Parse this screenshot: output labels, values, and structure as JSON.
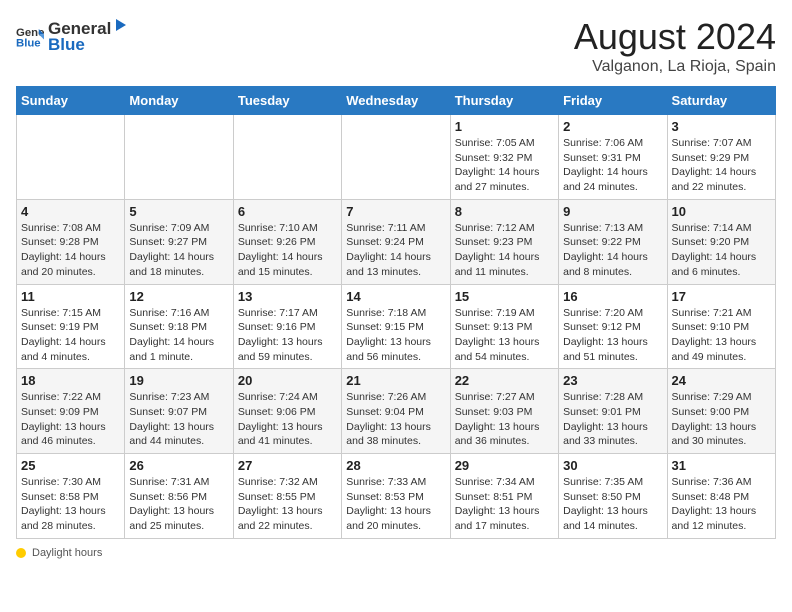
{
  "header": {
    "logo_general": "General",
    "logo_blue": "Blue",
    "month_year": "August 2024",
    "location": "Valganon, La Rioja, Spain"
  },
  "days_of_week": [
    "Sunday",
    "Monday",
    "Tuesday",
    "Wednesday",
    "Thursday",
    "Friday",
    "Saturday"
  ],
  "weeks": [
    [
      {
        "day": "",
        "info": ""
      },
      {
        "day": "",
        "info": ""
      },
      {
        "day": "",
        "info": ""
      },
      {
        "day": "",
        "info": ""
      },
      {
        "day": "1",
        "info": "Sunrise: 7:05 AM\nSunset: 9:32 PM\nDaylight: 14 hours and 27 minutes."
      },
      {
        "day": "2",
        "info": "Sunrise: 7:06 AM\nSunset: 9:31 PM\nDaylight: 14 hours and 24 minutes."
      },
      {
        "day": "3",
        "info": "Sunrise: 7:07 AM\nSunset: 9:29 PM\nDaylight: 14 hours and 22 minutes."
      }
    ],
    [
      {
        "day": "4",
        "info": "Sunrise: 7:08 AM\nSunset: 9:28 PM\nDaylight: 14 hours and 20 minutes."
      },
      {
        "day": "5",
        "info": "Sunrise: 7:09 AM\nSunset: 9:27 PM\nDaylight: 14 hours and 18 minutes."
      },
      {
        "day": "6",
        "info": "Sunrise: 7:10 AM\nSunset: 9:26 PM\nDaylight: 14 hours and 15 minutes."
      },
      {
        "day": "7",
        "info": "Sunrise: 7:11 AM\nSunset: 9:24 PM\nDaylight: 14 hours and 13 minutes."
      },
      {
        "day": "8",
        "info": "Sunrise: 7:12 AM\nSunset: 9:23 PM\nDaylight: 14 hours and 11 minutes."
      },
      {
        "day": "9",
        "info": "Sunrise: 7:13 AM\nSunset: 9:22 PM\nDaylight: 14 hours and 8 minutes."
      },
      {
        "day": "10",
        "info": "Sunrise: 7:14 AM\nSunset: 9:20 PM\nDaylight: 14 hours and 6 minutes."
      }
    ],
    [
      {
        "day": "11",
        "info": "Sunrise: 7:15 AM\nSunset: 9:19 PM\nDaylight: 14 hours and 4 minutes."
      },
      {
        "day": "12",
        "info": "Sunrise: 7:16 AM\nSunset: 9:18 PM\nDaylight: 14 hours and 1 minute."
      },
      {
        "day": "13",
        "info": "Sunrise: 7:17 AM\nSunset: 9:16 PM\nDaylight: 13 hours and 59 minutes."
      },
      {
        "day": "14",
        "info": "Sunrise: 7:18 AM\nSunset: 9:15 PM\nDaylight: 13 hours and 56 minutes."
      },
      {
        "day": "15",
        "info": "Sunrise: 7:19 AM\nSunset: 9:13 PM\nDaylight: 13 hours and 54 minutes."
      },
      {
        "day": "16",
        "info": "Sunrise: 7:20 AM\nSunset: 9:12 PM\nDaylight: 13 hours and 51 minutes."
      },
      {
        "day": "17",
        "info": "Sunrise: 7:21 AM\nSunset: 9:10 PM\nDaylight: 13 hours and 49 minutes."
      }
    ],
    [
      {
        "day": "18",
        "info": "Sunrise: 7:22 AM\nSunset: 9:09 PM\nDaylight: 13 hours and 46 minutes."
      },
      {
        "day": "19",
        "info": "Sunrise: 7:23 AM\nSunset: 9:07 PM\nDaylight: 13 hours and 44 minutes."
      },
      {
        "day": "20",
        "info": "Sunrise: 7:24 AM\nSunset: 9:06 PM\nDaylight: 13 hours and 41 minutes."
      },
      {
        "day": "21",
        "info": "Sunrise: 7:26 AM\nSunset: 9:04 PM\nDaylight: 13 hours and 38 minutes."
      },
      {
        "day": "22",
        "info": "Sunrise: 7:27 AM\nSunset: 9:03 PM\nDaylight: 13 hours and 36 minutes."
      },
      {
        "day": "23",
        "info": "Sunrise: 7:28 AM\nSunset: 9:01 PM\nDaylight: 13 hours and 33 minutes."
      },
      {
        "day": "24",
        "info": "Sunrise: 7:29 AM\nSunset: 9:00 PM\nDaylight: 13 hours and 30 minutes."
      }
    ],
    [
      {
        "day": "25",
        "info": "Sunrise: 7:30 AM\nSunset: 8:58 PM\nDaylight: 13 hours and 28 minutes."
      },
      {
        "day": "26",
        "info": "Sunrise: 7:31 AM\nSunset: 8:56 PM\nDaylight: 13 hours and 25 minutes."
      },
      {
        "day": "27",
        "info": "Sunrise: 7:32 AM\nSunset: 8:55 PM\nDaylight: 13 hours and 22 minutes."
      },
      {
        "day": "28",
        "info": "Sunrise: 7:33 AM\nSunset: 8:53 PM\nDaylight: 13 hours and 20 minutes."
      },
      {
        "day": "29",
        "info": "Sunrise: 7:34 AM\nSunset: 8:51 PM\nDaylight: 13 hours and 17 minutes."
      },
      {
        "day": "30",
        "info": "Sunrise: 7:35 AM\nSunset: 8:50 PM\nDaylight: 13 hours and 14 minutes."
      },
      {
        "day": "31",
        "info": "Sunrise: 7:36 AM\nSunset: 8:48 PM\nDaylight: 13 hours and 12 minutes."
      }
    ]
  ],
  "footer": {
    "daylight_label": "Daylight hours"
  }
}
